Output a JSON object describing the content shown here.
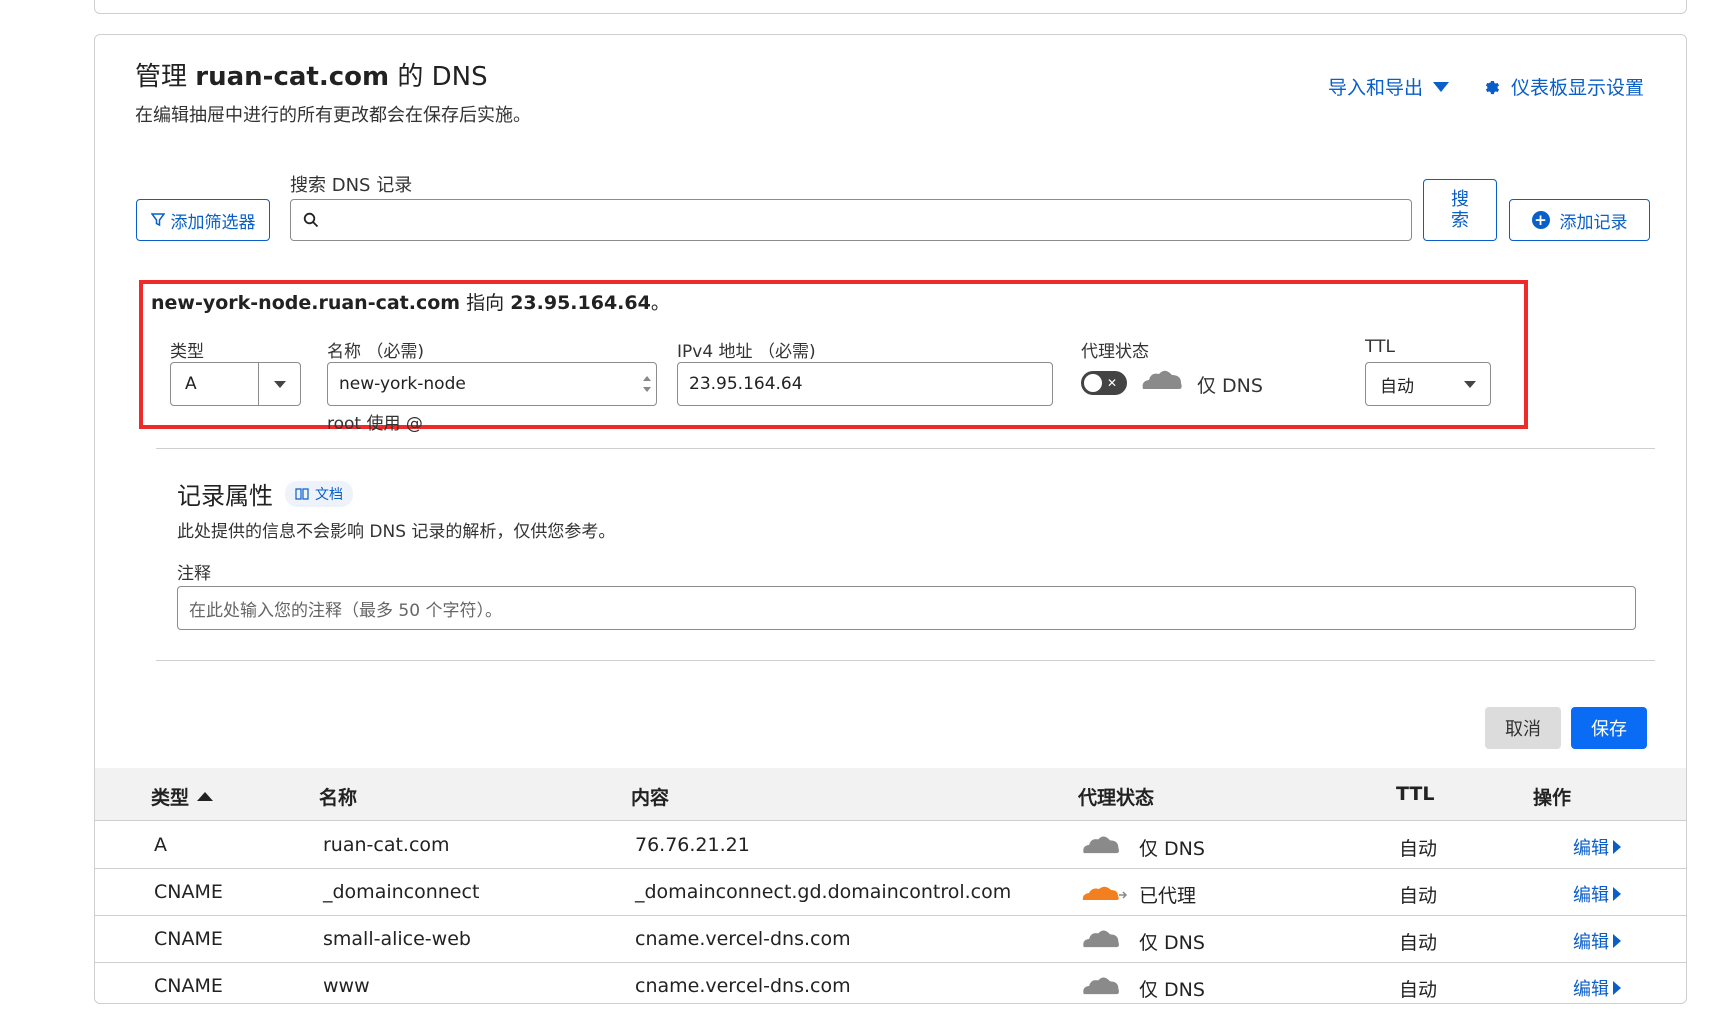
{
  "header": {
    "title_prefix": "管理",
    "domain": "ruan-cat.com",
    "title_suffix": "的 DNS",
    "subtitle": "在编辑抽屉中进行的所有更改都会在保存后实施。",
    "import_export": "导入和导出",
    "dashboard_settings": "仪表板显示设置"
  },
  "toolbar": {
    "filter_button": "添加筛选器",
    "search_label": "搜索 DNS 记录",
    "search_value": "",
    "search_button": "搜索",
    "add_record_button": "添加记录"
  },
  "editor": {
    "summary_name": "new-york-node.ruan-cat.com",
    "summary_mid": "指向",
    "summary_ip": "23.95.164.64",
    "summary_end": "。",
    "type_label": "类型",
    "type_value": "A",
    "name_label": "名称 （必需)",
    "name_value": "new-york-node",
    "name_hint": "root 使用 @",
    "ipv4_label": "IPv4 地址 （必需)",
    "ipv4_value": "23.95.164.64",
    "proxy_label": "代理状态",
    "proxy_value": "仅 DNS",
    "proxy_enabled": false,
    "ttl_label": "TTL",
    "ttl_value": "自动",
    "attr_title": "记录属性",
    "doc_badge": "文档",
    "attr_sub": "此处提供的信息不会影响 DNS 记录的解析，仅供您参考。",
    "note_label": "注释",
    "note_placeholder": "在此处输入您的注释（最多 50 个字符）。",
    "cancel_button": "取消",
    "save_button": "保存"
  },
  "table": {
    "headers": {
      "type": "类型",
      "name": "名称",
      "content": "内容",
      "proxy": "代理状态",
      "ttl": "TTL",
      "actions": "操作"
    },
    "rows": [
      {
        "type": "A",
        "name": "ruan-cat.com",
        "content": "76.76.21.21",
        "proxy": "仅 DNS",
        "proxied": false,
        "ttl": "自动",
        "action": "编辑"
      },
      {
        "type": "CNAME",
        "name": "_domainconnect",
        "content": "_domainconnect.gd.domaincontrol.com",
        "proxy": "已代理",
        "proxied": true,
        "ttl": "自动",
        "action": "编辑"
      },
      {
        "type": "CNAME",
        "name": "small-alice-web",
        "content": "cname.vercel-dns.com",
        "proxy": "仅 DNS",
        "proxied": false,
        "ttl": "自动",
        "action": "编辑"
      },
      {
        "type": "CNAME",
        "name": "www",
        "content": "cname.vercel-dns.com",
        "proxy": "仅 DNS",
        "proxied": false,
        "ttl": "自动",
        "action": "编辑"
      }
    ]
  },
  "colors": {
    "accent": "#0a5ec9",
    "primary_button": "#0a6cf5",
    "highlight_border": "#ee2a2a",
    "proxied_cloud": "#f38020",
    "dns_only_cloud": "#8a8a8a"
  }
}
